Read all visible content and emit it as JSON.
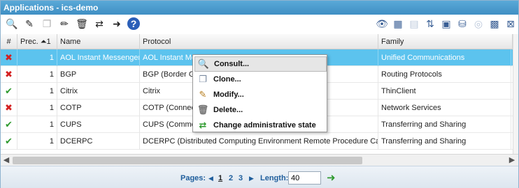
{
  "window": {
    "title": "Applications - ics-demo"
  },
  "toolbar": {
    "left": [
      {
        "icon": "magnifier-icon",
        "glyph": "🔍",
        "enabled": true
      },
      {
        "icon": "new-icon",
        "glyph": "✎",
        "enabled": true
      },
      {
        "icon": "clone-icon",
        "glyph": "❐",
        "enabled": false
      },
      {
        "icon": "edit-icon",
        "glyph": "✏",
        "enabled": true
      },
      {
        "icon": "trash-icon",
        "glyph": "🗑",
        "enabled": true
      },
      {
        "icon": "toggle-state-icon",
        "glyph": "⇄",
        "enabled": true
      },
      {
        "icon": "export-icon",
        "glyph": "➜",
        "enabled": true
      },
      {
        "icon": "help-icon",
        "glyph": "?",
        "enabled": true
      }
    ],
    "right": [
      {
        "icon": "binoculars-icon",
        "glyph": "👁",
        "enabled": true
      },
      {
        "icon": "grid-add-icon",
        "glyph": "▦",
        "enabled": true
      },
      {
        "icon": "grid-edit-icon",
        "glyph": "▤",
        "enabled": false
      },
      {
        "icon": "sort-icon",
        "glyph": "⇅",
        "enabled": true
      },
      {
        "icon": "report-icon",
        "glyph": "▣",
        "enabled": true
      },
      {
        "icon": "database-icon",
        "glyph": "⛁",
        "enabled": true
      },
      {
        "icon": "refresh-icon",
        "glyph": "◎",
        "enabled": false
      },
      {
        "icon": "select-all-icon",
        "glyph": "▩",
        "enabled": true
      },
      {
        "icon": "close-grid-icon",
        "glyph": "⊠",
        "enabled": true
      }
    ]
  },
  "grid": {
    "headers": {
      "status": "#",
      "prec": "Prec. ⏶1",
      "name": "Name",
      "protocol": "Protocol",
      "family": "Family"
    },
    "rows": [
      {
        "state": "✖",
        "ok": false,
        "prec": "1",
        "name": "AOL Instant Messenger",
        "protocol": "AOL Instant Messenger",
        "family": "Unified Communications"
      },
      {
        "state": "✖",
        "ok": false,
        "prec": "1",
        "name": "BGP",
        "protocol": "BGP (Border Gateway Protocol)",
        "family": "Routing Protocols"
      },
      {
        "state": "✔",
        "ok": true,
        "prec": "1",
        "name": "Citrix",
        "protocol": "Citrix",
        "family": "ThinClient"
      },
      {
        "state": "✖",
        "ok": false,
        "prec": "1",
        "name": "COTP",
        "protocol": "COTP (Connection Oriented Transport Protocol)",
        "family": "Network Services"
      },
      {
        "state": "✔",
        "ok": true,
        "prec": "1",
        "name": "CUPS",
        "protocol": "CUPS (Common Unix Printing System)",
        "family": "Transferring and Sharing"
      },
      {
        "state": "✔",
        "ok": true,
        "prec": "1",
        "name": "DCERPC",
        "protocol": "DCERPC (Distributed Computing Environment Remote Procedure Call)",
        "family": "Transferring and Sharing"
      }
    ]
  },
  "context_menu": {
    "items": [
      {
        "label": "Consult...",
        "icon": "magnifier-icon",
        "glyph": "🔍",
        "cls": "mag"
      },
      {
        "label": "Clone...",
        "icon": "clone-icon",
        "glyph": "❐",
        "cls": "doc"
      },
      {
        "label": "Modify...",
        "icon": "pencil-icon",
        "glyph": "✎",
        "cls": "pen"
      },
      {
        "label": "Delete...",
        "icon": "trash-icon",
        "glyph": "🗑",
        "cls": "bin"
      },
      {
        "label": "Change administrative state",
        "icon": "toggle-state-icon",
        "glyph": "⇄",
        "cls": "sw"
      }
    ]
  },
  "footer": {
    "pages_label": "Pages:",
    "pages": [
      "1",
      "2",
      "3"
    ],
    "current_page": "1",
    "prev_arrow": "◀",
    "next_arrow": "▶",
    "length_label": "Length:",
    "length_value": "40",
    "go_glyph": "➜"
  },
  "colors": {
    "title_bg": "#4a9bcf",
    "selected_row": "#5cc3ee",
    "ok": "#2e9a2e",
    "ko": "#d42020"
  }
}
